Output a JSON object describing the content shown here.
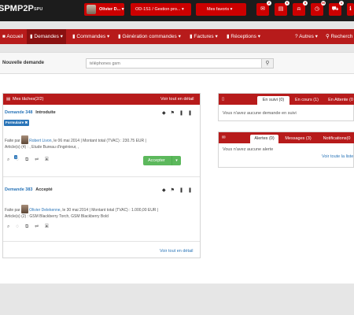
{
  "brand": {
    "logo_spm": "SPM",
    "logo_p2p": "P2P",
    "subtitle": "SPU"
  },
  "topbar": {
    "user_name": "Olivier D...",
    "org_selector": "OD-1S1 / Gestion pro...",
    "favorites": "Mes favoris",
    "icons": [
      {
        "name": "mail-icon",
        "glyph": "✉",
        "badge": "2"
      },
      {
        "name": "list-icon",
        "glyph": "▤",
        "badge": "6"
      },
      {
        "name": "bell-icon",
        "glyph": "🔔",
        "badge": "3"
      },
      {
        "name": "clock-icon",
        "glyph": "◷",
        "badge": "99"
      },
      {
        "name": "cart-icon",
        "glyph": "🛒",
        "badge": "1"
      },
      {
        "name": "info-icon",
        "glyph": "ℹ",
        "badge": ""
      }
    ]
  },
  "nav": {
    "accueil": "Accueil",
    "demandes": "Demandes",
    "commandes": "Commandes",
    "generation": "Génération commandes",
    "factures": "Factures",
    "receptions": "Réceptions",
    "autres": "Autres",
    "recherche": "Recherch"
  },
  "subbar": {
    "title": "Nouvelle demande",
    "search_placeholder": "téléphones gsm"
  },
  "tasks_panel": {
    "title": "Mes tâches(2/2)",
    "see_all": "Voir tout en détail",
    "see_all_bottom": "Voir tout en détail",
    "tasks": [
      {
        "id": "Demande 348",
        "status": "Introduite",
        "tag": "Formulaire ✖",
        "line1_prefix": "Faite par",
        "author": "Robert Livon",
        "line1_suffix": ", le 06 mai 2014 | Montant total (TVAC) : 230.75  EUR |",
        "line2": "Article(s) (4) : , Etude Bureau d'ingénieur, ,",
        "comment_badge": "1",
        "accept": "Accepter"
      },
      {
        "id": "Demande 383",
        "status": "Accepté",
        "line1_prefix": "Faite par",
        "author": "Olivier Delekenne",
        "line1_suffix": ", le 30 mai 2014 | Montant total (TVAC) : 1.000,00  EUR |",
        "line2": "Article(s) (2) : GSM Blackberry Torch, GSM Blackberry Bold"
      }
    ]
  },
  "followup_panel": {
    "tabs": [
      "En suivi (0)",
      "En cours (1)",
      "En Attente (0"
    ],
    "empty_text": "Vous n'avez aucune demande en suivi"
  },
  "alerts_panel": {
    "tabs": [
      "Alertes (0)",
      "Messages (3)",
      "Notifications(0"
    ],
    "empty_text": "Vous n'avez aucune alerte",
    "see_all": "Voir toute la liste"
  }
}
